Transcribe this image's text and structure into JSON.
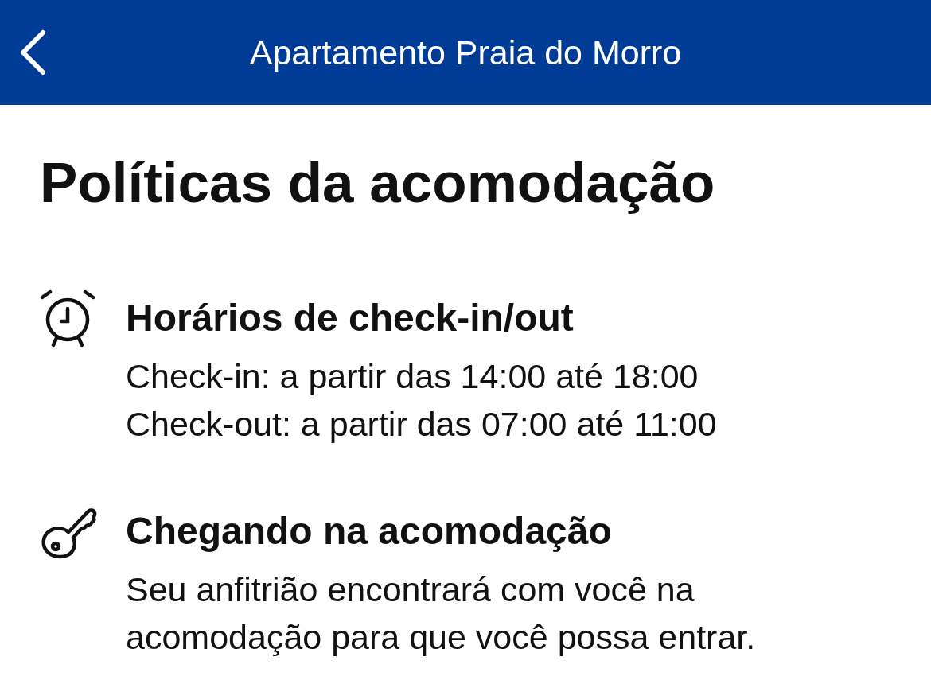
{
  "header": {
    "title": "Apartamento Praia do Morro"
  },
  "page_title": "Políticas da acomodação",
  "sections": [
    {
      "kind": "clock",
      "heading": "Horários de check-in/out",
      "lines": [
        "Check-in: a partir das 14:00 até 18:00",
        "Check-out: a partir das 07:00 até 11:00"
      ]
    },
    {
      "kind": "key",
      "heading": "Chegando na acomodação",
      "lines": [
        "Seu anfitrião encontrará com você na acomodação para que você possa entrar."
      ]
    }
  ]
}
